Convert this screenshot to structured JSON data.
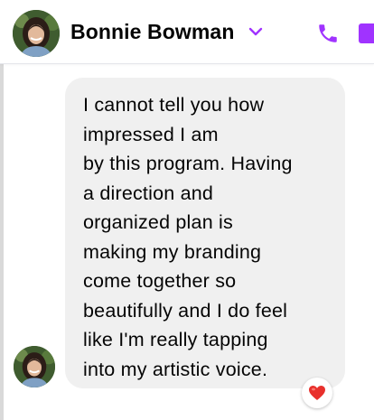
{
  "header": {
    "contact_name": "Bonnie Bowman",
    "avatar_icon": "profile-photo",
    "chevron_icon": "chevron-down-icon",
    "phone_icon": "phone-icon",
    "video_icon": "video-camera-icon"
  },
  "message": {
    "text": "I cannot tell you how\nimpressed I am\nby this program. Having\na direction and\norganized plan is\nmaking my branding\ncome together so\nbeautifully and I do feel\nlike I'm really tapping\ninto my artistic voice.",
    "reaction_icon": "heart-icon"
  },
  "colors": {
    "accent": "#a033ff",
    "bubble": "#f0f0f0",
    "reaction_heart": "#e8302c"
  }
}
